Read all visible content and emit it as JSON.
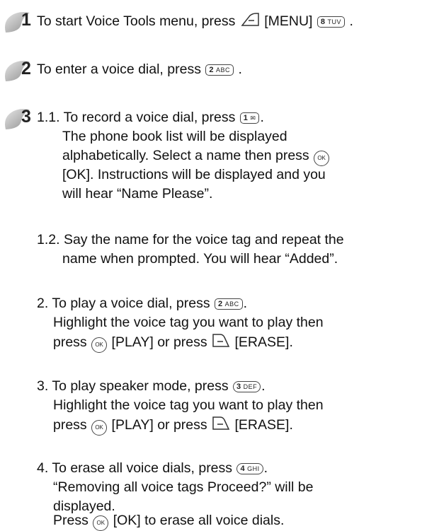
{
  "steps": [
    {
      "number": "1",
      "text_a": "To start Voice Tools menu, press",
      "text_b": "[MENU]",
      "key_label": "8",
      "key_sub": "TUV",
      "text_c": "."
    },
    {
      "number": "2",
      "text_a": "To enter a voice dial, press",
      "key_label": "2",
      "key_sub": "ABC",
      "text_c": "."
    },
    {
      "number": "3",
      "l1_a": "1.1. To record a voice dial, press",
      "l1_key": "1",
      "l1_c": ".",
      "l2": "The phone book list will be displayed",
      "l3_a": "alphabetically. Select a name then press",
      "l3_key": "OK",
      "l4": "[OK]. Instructions will be displayed and you",
      "l5": "will hear “Name Please”.",
      "l6": "1.2. Say the name for the voice tag and repeat the",
      "l7": "name when prompted. You will hear “Added”.",
      "l8_a": "2. To play a voice dial, press",
      "l8_key": "2",
      "l8_sub": "ABC",
      "l8_c": ".",
      "l9": "Highlight the voice tag you want to play then",
      "l10_a": "press",
      "l10_key": "OK",
      "l10_b": "[PLAY] or press",
      "l10_c": "[ERASE].",
      "l11_a": "3. To play speaker mode, press",
      "l11_key": "3",
      "l11_sub": "DEF",
      "l11_c": ".",
      "l12": "Highlight the voice tag you want to play then",
      "l13_a": "press",
      "l13_key": "OK",
      "l13_b": "[PLAY] or press",
      "l13_c": "[ERASE].",
      "l14_a": "4. To erase all voice dials, press",
      "l14_key": "4",
      "l14_sub": "GHI",
      "l14_c": ".",
      "l15": "“Removing all voice tags Proceed?” will be",
      "l16": "displayed.",
      "l17_a": "Press",
      "l17_key": "OK",
      "l17_b": "[OK] to erase all voice dials."
    }
  ],
  "icons": [
    "step-badge-icon",
    "left-softkey-icon",
    "end-key-icon",
    "ok-key-icon"
  ],
  "colors": {
    "badge_gray": "#bfbfbf",
    "badge_dark": "#8a8a8a"
  }
}
